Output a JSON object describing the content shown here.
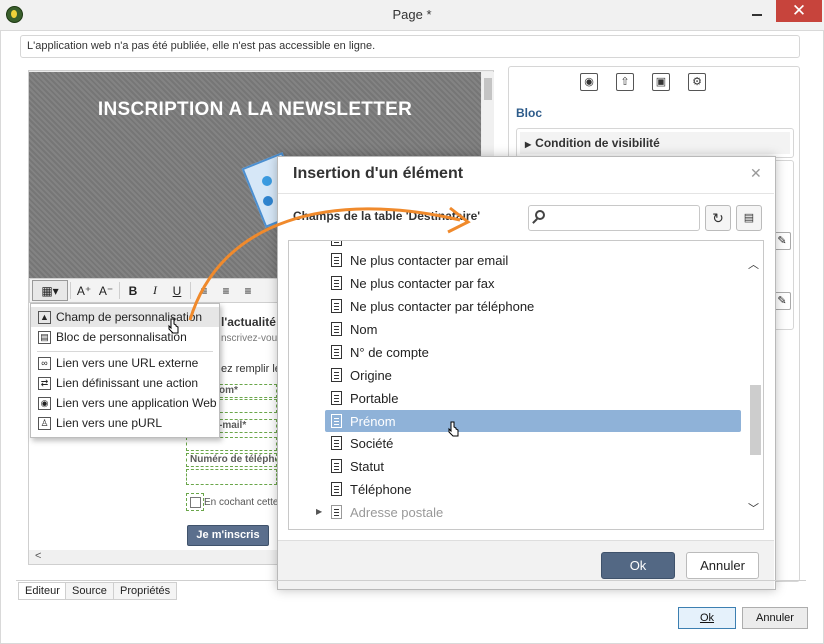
{
  "window": {
    "title": "Page *",
    "close_glyph": "✕",
    "minimize_icon": "minimize-icon"
  },
  "info_bar": {
    "text": "L'application web n'a pas été publiée, elle n'est pas accessible en ligne."
  },
  "editor": {
    "hero_title": "INSCRIPTION A LA NEWSLETTER",
    "toolbar": {
      "format": "▾",
      "font_up": "A⁺",
      "font_down": "A⁻",
      "bold": "B",
      "italic": "I",
      "underline": "U"
    },
    "bg_texts": {
      "heading_fragment": "l'actualité",
      "sub_fragment": "nscrivez-vou",
      "fill_fragment": "ez remplir le",
      "field1": "om*",
      "field2": "-mail*",
      "field3": "Numéro de télépho",
      "checkbox": "En cochant cette"
    },
    "submit_label": "Je m'inscris"
  },
  "context_menu": {
    "items": [
      {
        "label": "Champ de personnalisation",
        "icon": "person-field-icon"
      },
      {
        "label": "Bloc de personnalisation",
        "icon": "block-icon"
      },
      {
        "label": "Lien vers une URL externe",
        "icon": "link-www-icon"
      },
      {
        "label": "Lien définissant une action",
        "icon": "link-action-icon"
      },
      {
        "label": "Lien vers une application Web",
        "icon": "link-webapp-icon"
      },
      {
        "label": "Lien vers une pURL",
        "icon": "link-purl-icon"
      }
    ]
  },
  "right_panel": {
    "icons": [
      "eye-icon",
      "upload-icon",
      "save-icon",
      "settings-icon"
    ],
    "section_title": "Bloc",
    "accordion_label": "Condition de visibilité"
  },
  "dialog": {
    "title": "Insertion d'un élément",
    "close_glyph": "✕",
    "list_label": "Champs de la table 'Destinataire'",
    "search_value": "",
    "refresh_glyph": "↻",
    "list_items": [
      {
        "label": "Ne plus contacter par email",
        "selected": false
      },
      {
        "label": "Ne plus contacter par fax",
        "selected": false
      },
      {
        "label": "Ne plus contacter par téléphone",
        "selected": false
      },
      {
        "label": "Nom",
        "selected": false
      },
      {
        "label": "N° de compte",
        "selected": false
      },
      {
        "label": "Origine",
        "selected": false
      },
      {
        "label": "Portable",
        "selected": false
      },
      {
        "label": "Prénom",
        "selected": true
      },
      {
        "label": "Société",
        "selected": false
      },
      {
        "label": "Statut",
        "selected": false
      },
      {
        "label": "Téléphone",
        "selected": false
      }
    ],
    "group_item": "Adresse postale",
    "ok_label": "Ok",
    "cancel_label": "Annuler"
  },
  "tabs": [
    {
      "label": "Editeur",
      "active": true
    },
    {
      "label": "Source",
      "active": false
    },
    {
      "label": "Propriétés",
      "active": false
    }
  ],
  "footer": {
    "ok_label": "Ok",
    "cancel_label": "Annuler"
  },
  "colors": {
    "selection": "#8fb2d8",
    "primary_button": "#536884",
    "close_button": "#c7443c",
    "accent_arrow": "#f08a2c"
  }
}
